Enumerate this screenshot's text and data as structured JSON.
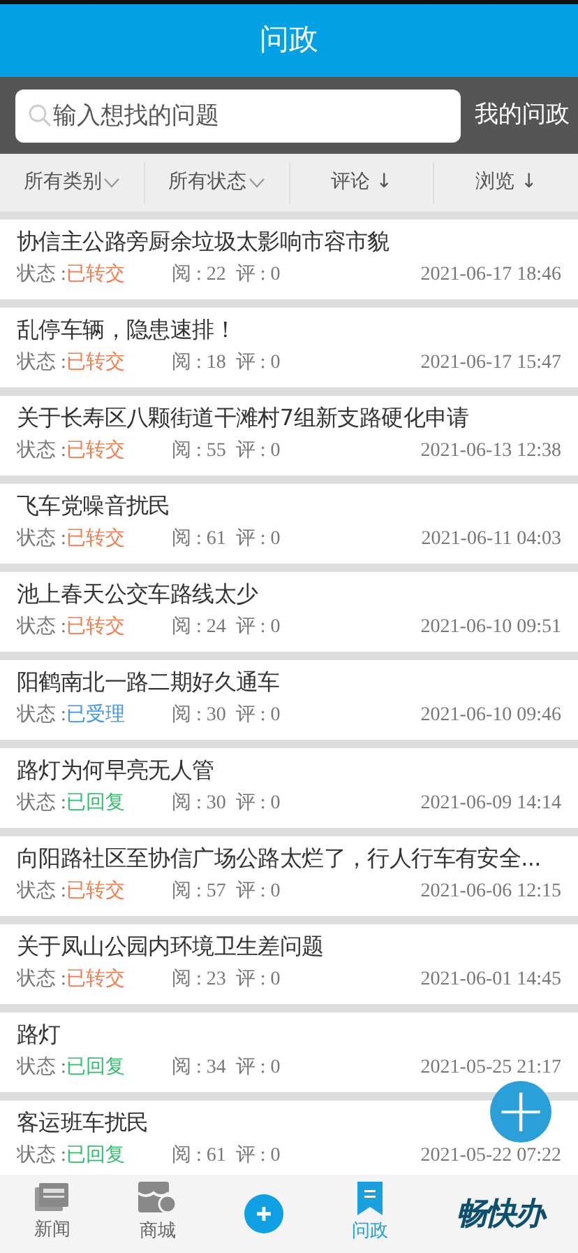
{
  "header": {
    "title": "问政"
  },
  "search": {
    "placeholder": "输入想找的问题",
    "my_button": "我的问政"
  },
  "filters": [
    {
      "label": "所有类别",
      "kind": "dropdown"
    },
    {
      "label": "所有状态",
      "kind": "dropdown"
    },
    {
      "label": "评论 ↓",
      "kind": "sort"
    },
    {
      "label": "浏览 ↓",
      "kind": "sort"
    }
  ],
  "items": [
    {
      "title": "协信主公路旁厨余垃圾太影响市容市貌",
      "status_label": "状态 :",
      "status": "已转交",
      "color": "#f47b4a",
      "stats": "阅 : 22  评 : 0",
      "time": "2021-06-17 18:46"
    },
    {
      "title": "乱停车辆，隐患速排！",
      "status_label": "状态 :",
      "status": "已转交",
      "color": "#f47b4a",
      "stats": "阅 : 18  评 : 0",
      "time": "2021-06-17 15:47"
    },
    {
      "title": "关于长寿区八颗街道干滩村7组新支路硬化申请",
      "status_label": "状态 :",
      "status": "已转交",
      "color": "#f47b4a",
      "stats": "阅 : 55  评 : 0",
      "time": "2021-06-13 12:38"
    },
    {
      "title": "飞车党噪音扰民",
      "status_label": "状态 :",
      "status": "已转交",
      "color": "#f47b4a",
      "stats": "阅 : 61  评 : 0",
      "time": "2021-06-11 04:03"
    },
    {
      "title": "池上春天公交车路线太少",
      "status_label": "状态 :",
      "status": "已转交",
      "color": "#f47b4a",
      "stats": "阅 : 24  评 : 0",
      "time": "2021-06-10 09:51"
    },
    {
      "title": "阳鹤南北一路二期好久通车",
      "status_label": "状态 :",
      "status": "已受理",
      "color": "#3d94f0",
      "stats": "阅 : 30  评 : 0",
      "time": "2021-06-10 09:46"
    },
    {
      "title": "路灯为何早亮无人管",
      "status_label": "状态 :",
      "status": "已回复",
      "color": "#2fbf6a",
      "stats": "阅 : 30  评 : 0",
      "time": "2021-06-09 14:14"
    },
    {
      "title": "向阳路社区至协信广场公路太烂了，行人行车有安全...",
      "status_label": "状态 :",
      "status": "已转交",
      "color": "#f47b4a",
      "stats": "阅 : 57  评 : 0",
      "time": "2021-06-06 12:15"
    },
    {
      "title": "关于凤山公园内环境卫生差问题",
      "status_label": "状态 :",
      "status": "已转交",
      "color": "#f47b4a",
      "stats": "阅 : 23  评 : 0",
      "time": "2021-06-01 14:45"
    },
    {
      "title": "路灯",
      "status_label": "状态 :",
      "status": "已回复",
      "color": "#2fbf6a",
      "stats": "阅 : 34  评 : 0",
      "time": "2021-05-25 21:17"
    },
    {
      "title": "客运班车扰民",
      "status_label": "状态 :",
      "status": "已回复",
      "color": "#2fbf6a",
      "stats": "阅 : 61  评 : 0",
      "time": "2021-05-22 07:22"
    }
  ],
  "fab": {
    "symbol": "+"
  },
  "tabbar": [
    {
      "label": "新闻",
      "kind": "news",
      "selected": false
    },
    {
      "label": "商城",
      "kind": "mall",
      "selected": false
    },
    {
      "kind": "add",
      "selected": false
    },
    {
      "label": "问政",
      "kind": "ask",
      "selected": true
    },
    {
      "label": "畅快办",
      "kind": "logo",
      "selected": false
    }
  ]
}
